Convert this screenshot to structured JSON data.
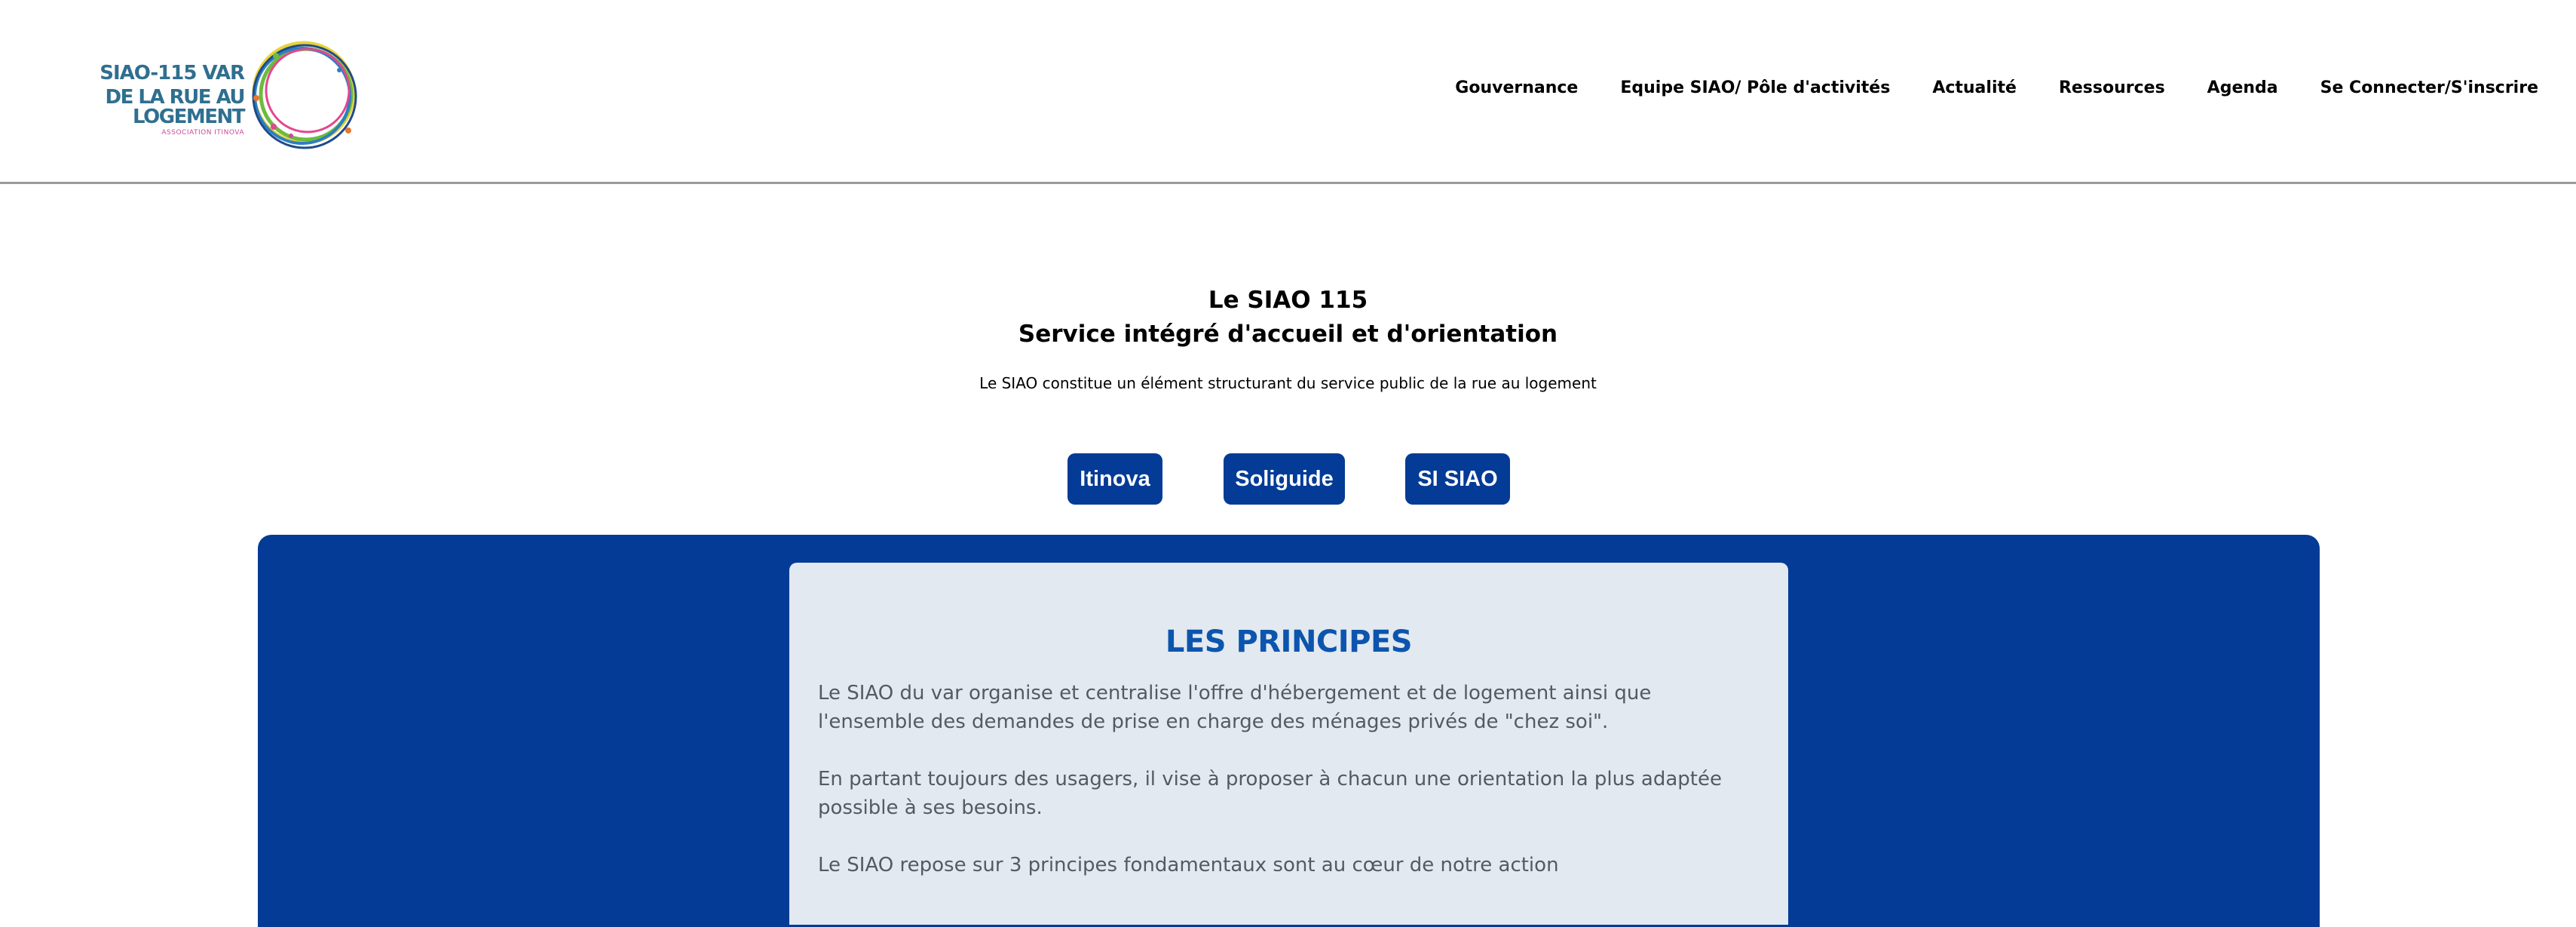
{
  "header": {
    "logo": {
      "line1": "SIAO-115 VAR",
      "line2": "DE LA RUE AU LOGEMENT",
      "line3": "ASSOCIATION ITINOVA"
    },
    "nav": [
      {
        "label": "Gouvernance"
      },
      {
        "label": "Equipe SIAO/ Pôle d'activités"
      },
      {
        "label": "Actualité"
      },
      {
        "label": "Ressources"
      },
      {
        "label": "Agenda"
      },
      {
        "label": "Se Connecter/S'inscrire"
      }
    ]
  },
  "intro": {
    "title1": "Le SIAO 115",
    "title2": "Service intégré d'accueil et d'orientation",
    "subtitle": "Le SIAO constitue un élément structurant du service public de la rue au logement"
  },
  "buttons": {
    "itinova": "Itinova",
    "soliguide": "Soliguide",
    "sisiao": "SI SIAO"
  },
  "principles": {
    "title": "LES PRINCIPES",
    "p1": "Le SIAO du var organise et centralise l'offre d'hébergement et de logement ainsi que l'ensemble des demandes de prise en charge des ménages privés de \"chez soi\".",
    "p2": "En partant toujours des usagers, il vise à proposer à chacun une orientation la plus adaptée possible à ses besoins.",
    "p3": "Le SIAO repose sur 3 principes fondamentaux sont au cœur de notre action"
  },
  "colors": {
    "brand_blue": "#033b96",
    "title_blue": "#0c55ae",
    "card_bg": "#e3e9f0",
    "logo_teal": "#2f6f8f"
  }
}
